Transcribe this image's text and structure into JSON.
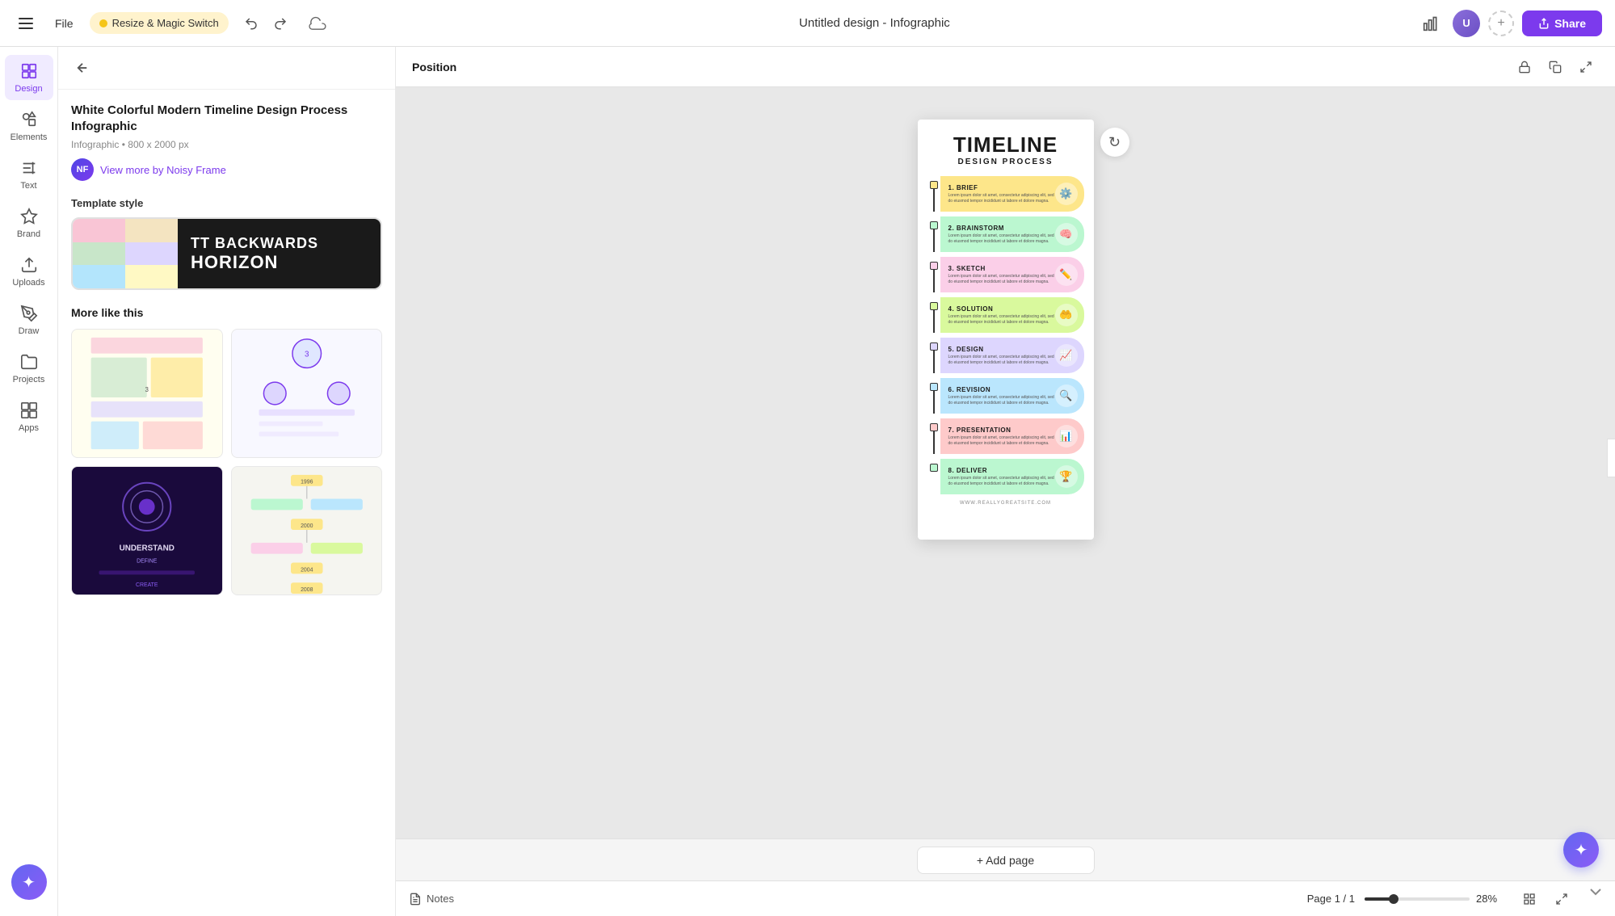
{
  "topbar": {
    "file_label": "File",
    "resize_label": "Resize & Magic Switch",
    "doc_title": "Untitled design - Infographic",
    "share_label": "Share"
  },
  "sidebar": {
    "items": [
      {
        "id": "design",
        "label": "Design",
        "active": true
      },
      {
        "id": "elements",
        "label": "Elements",
        "active": false
      },
      {
        "id": "text",
        "label": "Text",
        "active": false
      },
      {
        "id": "brand",
        "label": "Brand",
        "active": false
      },
      {
        "id": "uploads",
        "label": "Uploads",
        "active": false
      },
      {
        "id": "draw",
        "label": "Draw",
        "active": false
      },
      {
        "id": "projects",
        "label": "Projects",
        "active": false
      },
      {
        "id": "apps",
        "label": "Apps",
        "active": false
      }
    ]
  },
  "panel": {
    "template_title": "White Colorful Modern Timeline Design Process Infographic",
    "template_type": "Infographic",
    "template_size": "800 x 2000 px",
    "author_initials": "NF",
    "view_more_label": "View more by Noisy Frame",
    "template_style_label": "Template style",
    "font_1": "TT BACKWARDS",
    "font_2": "HORIZON",
    "more_like_label": "More like this"
  },
  "canvas": {
    "position_label": "Position",
    "infographic": {
      "title": "TIMELINE",
      "subtitle": "DESIGN PROCESS",
      "steps": [
        {
          "num": "1",
          "title": "1. BRIEF",
          "color_class": "step-1",
          "icon": "⚙️",
          "body": "Lorem ipsum dolor sit amet, consectetur adipiscing elit, sed do eiusmod tempor incididunt ut labore et dolore magna aliqua."
        },
        {
          "num": "2",
          "title": "2. BRAINSTORM",
          "color_class": "step-2",
          "icon": "🧠",
          "body": "Lorem ipsum dolor sit amet, consectetur adipiscing elit, sed do eiusmod tempor incididunt ut labore et dolore magna aliqua."
        },
        {
          "num": "3",
          "title": "3. SKETCH",
          "color_class": "step-3",
          "icon": "✏️",
          "body": "Lorem ipsum dolor sit amet, consectetur adipiscing elit, sed do eiusmod tempor incididunt ut labore et dolore magna aliqua."
        },
        {
          "num": "4",
          "title": "4. SOLUTION",
          "color_class": "step-4",
          "icon": "🤲",
          "body": "Lorem ipsum dolor sit amet, consectetur adipiscing elit, sed do eiusmod tempor incididunt ut labore et dolore magna aliqua."
        },
        {
          "num": "5",
          "title": "5. DESIGN",
          "color_class": "step-5",
          "icon": "📈",
          "body": "Lorem ipsum dolor sit amet, consectetur adipiscing elit, sed do eiusmod tempor incididunt ut labore et dolore magna aliqua."
        },
        {
          "num": "6",
          "title": "6. REVISION",
          "color_class": "step-6",
          "icon": "🔍",
          "body": "Lorem ipsum dolor sit amet, consectetur adipiscing elit, sed do eiusmod tempor incididunt ut labore et dolore magna aliqua."
        },
        {
          "num": "7",
          "title": "7. PRESENTATION",
          "color_class": "step-7",
          "icon": "📊",
          "body": "Lorem ipsum dolor sit amet, consectetur adipiscing elit, sed do eiusmod tempor incididunt ut labore et dolore magna aliqua."
        },
        {
          "num": "8",
          "title": "8. DELIVER",
          "color_class": "step-8",
          "icon": "🏆",
          "body": "Lorem ipsum dolor sit amet, consectetur adipiscing elit, sed do eiusmod tempor incididunt ut labore et dolore magna aliqua."
        }
      ],
      "footer": "WWW.REALLYGREATSITE.COM"
    }
  },
  "bottom": {
    "notes_label": "Notes",
    "page_info": "Page 1 / 1",
    "zoom_pct": "28%",
    "add_page_label": "+ Add page"
  },
  "style_colors": [
    [
      "#f9c5d5",
      "#f4e4c1"
    ],
    [
      "#c8e6c9",
      "#ddd6fe"
    ],
    [
      "#b3e5fc",
      "#fff9c4"
    ]
  ]
}
